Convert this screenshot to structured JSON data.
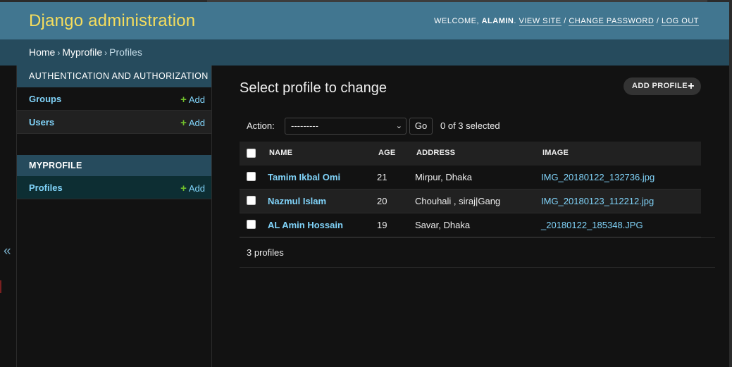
{
  "header": {
    "site_name": "Django administration",
    "welcome": "Welcome,",
    "username": "alamin",
    "view_site": "View site",
    "change_password": "Change password",
    "log_out": "Log out",
    "sep": "/"
  },
  "breadcrumbs": {
    "home": "Home",
    "app": "Myprofile",
    "current": "Profiles",
    "sep": "›"
  },
  "sidebar": {
    "toggle": "«",
    "modules": [
      {
        "caption": "Authentication and Authorization",
        "models": [
          {
            "name": "Groups",
            "add": "Add"
          },
          {
            "name": "Users",
            "add": "Add"
          }
        ]
      },
      {
        "caption": "MYPROFILE",
        "models": [
          {
            "name": "Profiles",
            "add": "Add"
          }
        ]
      }
    ]
  },
  "content": {
    "title": "Select profile to change",
    "add_button": "Add profile",
    "actions": {
      "label": "Action:",
      "selected_option": "---------",
      "go": "Go",
      "counter": "0 of 3 selected"
    },
    "table": {
      "columns": [
        "NAME",
        "AGE",
        "ADDRESS",
        "IMAGE"
      ],
      "rows": [
        {
          "name": "Tamim Ikbal Omi",
          "age": "21",
          "address": "Mirpur, Dhaka",
          "image": "IMG_20180122_132736.jpg"
        },
        {
          "name": "Nazmul Islam",
          "age": "20",
          "address": "Chouhali , siraj|Gang",
          "image": "IMG_20180123_112212.jpg"
        },
        {
          "name": "AL Amin Hossain",
          "age": "19",
          "address": "Savar, Dhaka",
          "image": "_20180122_185348.JPG"
        }
      ]
    },
    "paginator": "3 profiles"
  },
  "colors": {
    "header_bg": "#417690",
    "breadcrumb_bg": "#264b5d",
    "branding": "#f5dd5d",
    "link": "#81d4fa",
    "add_icon": "#70bf2b",
    "body_bg": "#121212"
  }
}
